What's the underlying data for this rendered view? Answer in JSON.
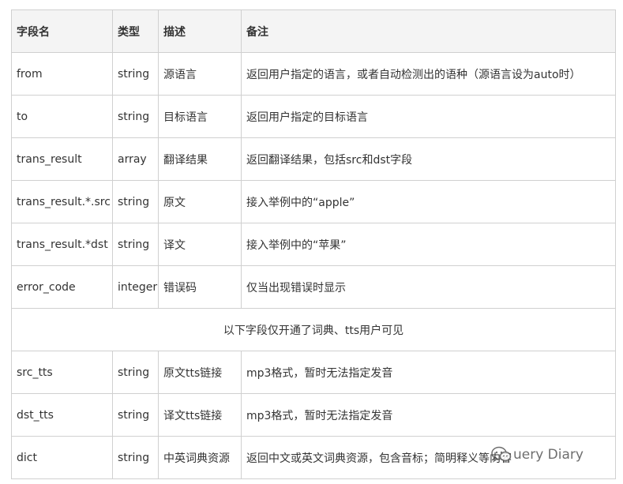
{
  "table": {
    "headers": [
      "字段名",
      "类型",
      "描述",
      "备注"
    ],
    "rows": [
      {
        "field": "from",
        "type": "string",
        "desc": "源语言",
        "note": "返回用户指定的语言，或者自动检测出的语种（源语言设为auto时）"
      },
      {
        "field": "to",
        "type": "string",
        "desc": "目标语言",
        "note": "返回用户指定的目标语言"
      },
      {
        "field": "trans_result",
        "type": "array",
        "desc": "翻译结果",
        "note": "返回翻译结果，包括src和dst字段"
      },
      {
        "field": "trans_result.*.src",
        "type": "string",
        "desc": "原文",
        "note": "接入举例中的“apple”"
      },
      {
        "field": "trans_result.*dst",
        "type": "string",
        "desc": "译文",
        "note": "接入举例中的“苹果”"
      },
      {
        "field": "error_code",
        "type": "integer",
        "desc": "错误码",
        "note": "仅当出现错误时显示"
      }
    ],
    "section_note": "以下字段仅开通了词典、tts用户可见",
    "rows_after": [
      {
        "field": "src_tts",
        "type": "string",
        "desc": "原文tts链接",
        "note": "mp3格式，暂时无法指定发音"
      },
      {
        "field": "dst_tts",
        "type": "string",
        "desc": "译文tts链接",
        "note": "mp3格式，暂时无法指定发音"
      },
      {
        "field": "dict",
        "type": "string",
        "desc": "中英词典资源",
        "note": "返回中文或英文词典资源，包含音标；简明释义等内容"
      }
    ]
  },
  "watermark": {
    "text": "uery Diary",
    "icon": "wechat-icon"
  },
  "colors": {
    "header_bg": "#f4f4f4",
    "border": "#d0d0d0",
    "text": "#333333"
  }
}
